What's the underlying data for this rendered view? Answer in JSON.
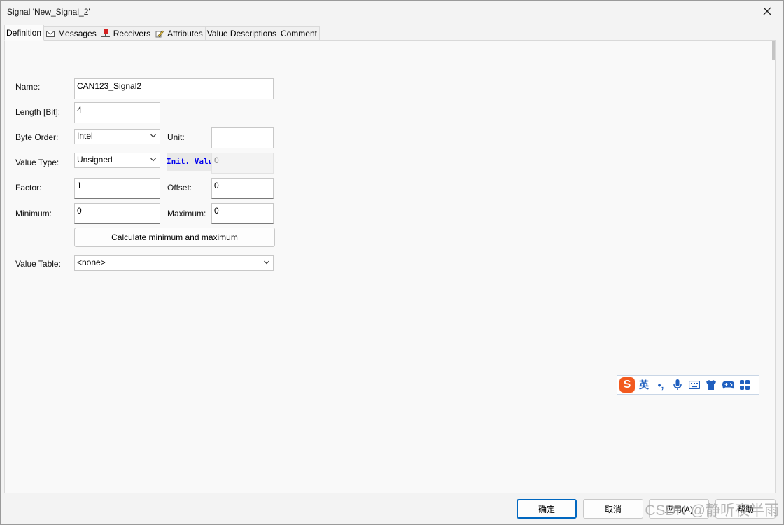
{
  "window": {
    "title": "Signal 'New_Signal_2'"
  },
  "tabs": [
    {
      "label": "Definition",
      "icon": ""
    },
    {
      "label": "Messages",
      "icon": "envelope-icon"
    },
    {
      "label": "Receivers",
      "icon": "node-icon"
    },
    {
      "label": "Attributes",
      "icon": "edit-pencil-icon"
    },
    {
      "label": "Value Descriptions",
      "icon": ""
    },
    {
      "label": "Comment",
      "icon": ""
    }
  ],
  "form": {
    "name_label": "Name:",
    "name_value": "CAN123_Signal2",
    "length_label": "Length [Bit]:",
    "length_value": "4",
    "byte_order_label": "Byte Order:",
    "byte_order_value": "Intel",
    "unit_label": "Unit:",
    "unit_value": "",
    "value_type_label": "Value Type:",
    "value_type_value": "Unsigned",
    "init_value_label": "Init. Value",
    "init_value_value": "0",
    "factor_label": "Factor:",
    "factor_value": "1",
    "offset_label": "Offset:",
    "offset_value": "0",
    "minimum_label": "Minimum:",
    "minimum_value": "0",
    "maximum_label": "Maximum:",
    "maximum_value": "0",
    "calc_button": "Calculate minimum and maximum",
    "value_table_label": "Value Table:",
    "value_table_value": "<none>"
  },
  "ime": {
    "logo": "S",
    "lang": "英",
    "punct": "•,",
    "icons": [
      "microphone-icon",
      "keyboard-icon",
      "tshirt-icon",
      "gamepad-icon",
      "grid-icon"
    ]
  },
  "footer": {
    "ok": "确定",
    "cancel": "取消",
    "apply": "应用(A)",
    "help": "帮助"
  },
  "watermark": "CSDN @静听夜半雨",
  "colors": {
    "primary_border": "#0067c0",
    "link": "#0000ee",
    "ime_logo": "#f25a1f",
    "ime_icon": "#1f5fbf"
  }
}
